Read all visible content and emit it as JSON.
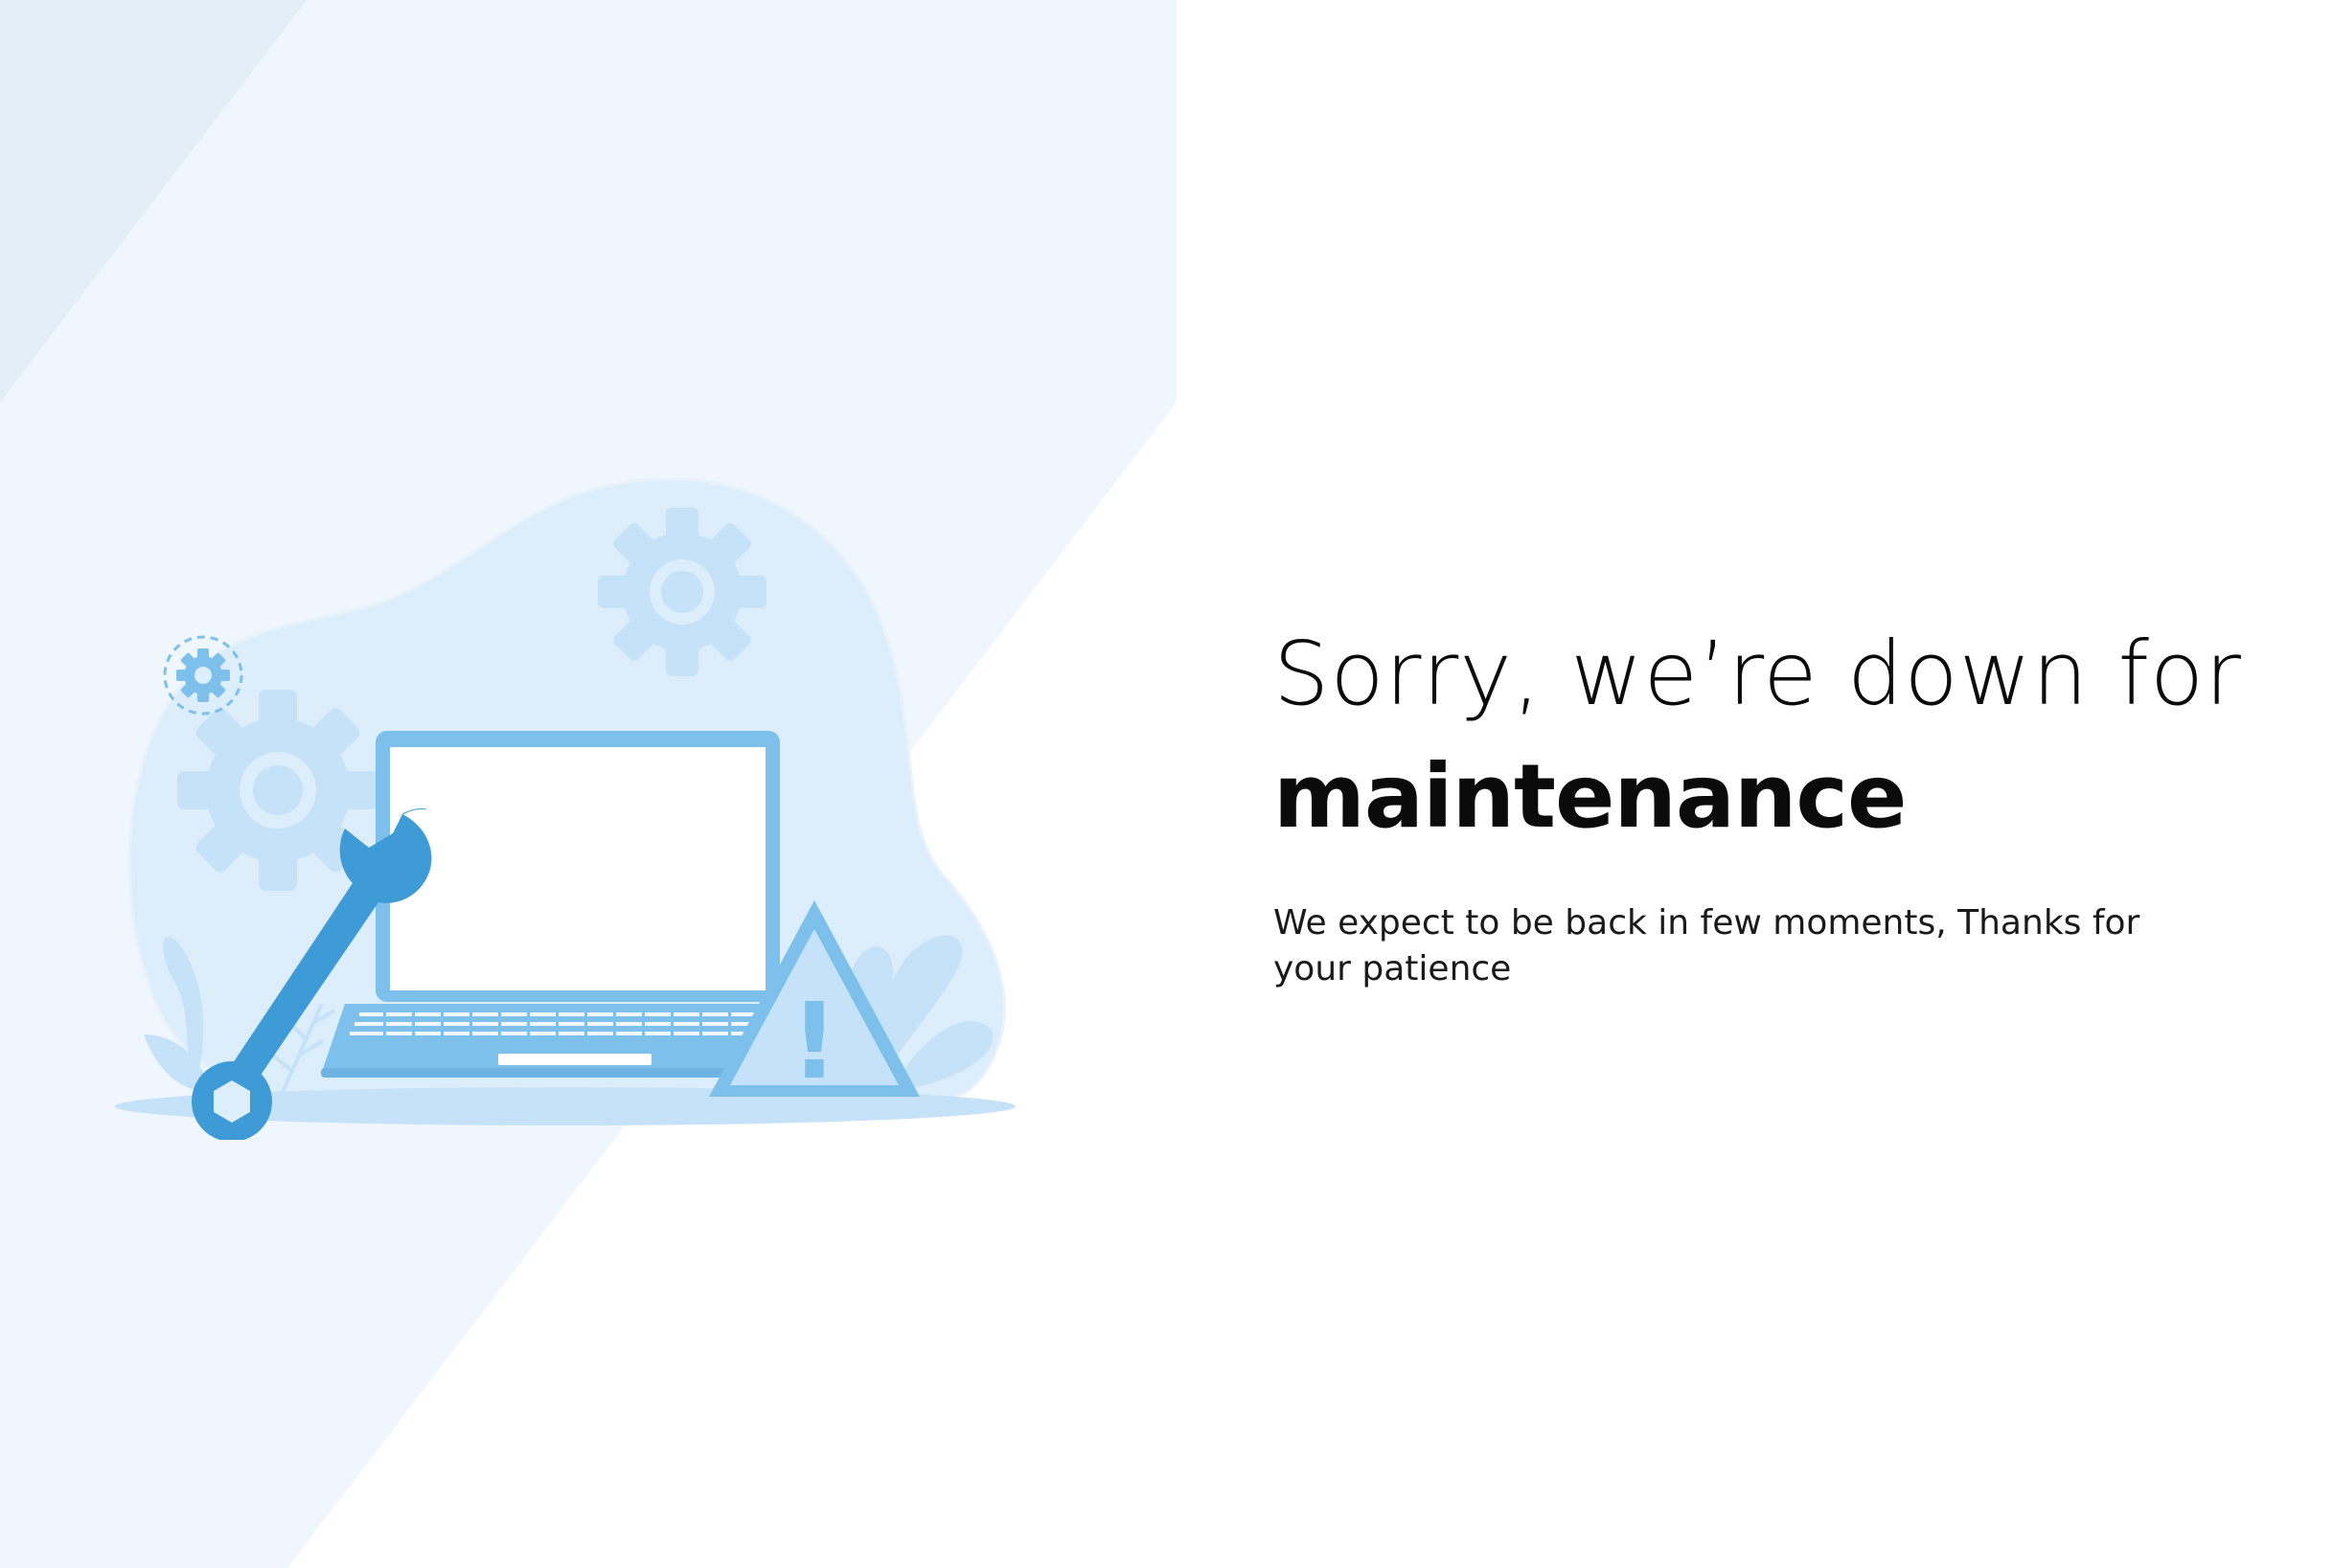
{
  "page": {
    "headline_light": "Sorry, we’re down for",
    "headline_bold": "maintenance",
    "subtext": "We expect to be back in few moments, Thanks for your patience"
  },
  "illustration": {
    "icons": [
      "laptop-icon",
      "wrench-icon",
      "gear-icon",
      "warning-icon",
      "leaf-icon"
    ],
    "warning_symbol": "!"
  },
  "colors": {
    "background": "#ffffff",
    "panel_light": "#eef5fc",
    "panel_dark": "#e3eef7",
    "blob": "#dcedfb",
    "accent_blue": "#7cc0eb",
    "accent_dark_blue": "#3f9bd5",
    "gear_light": "#c6e2f8",
    "text": "#0b0b0b"
  }
}
